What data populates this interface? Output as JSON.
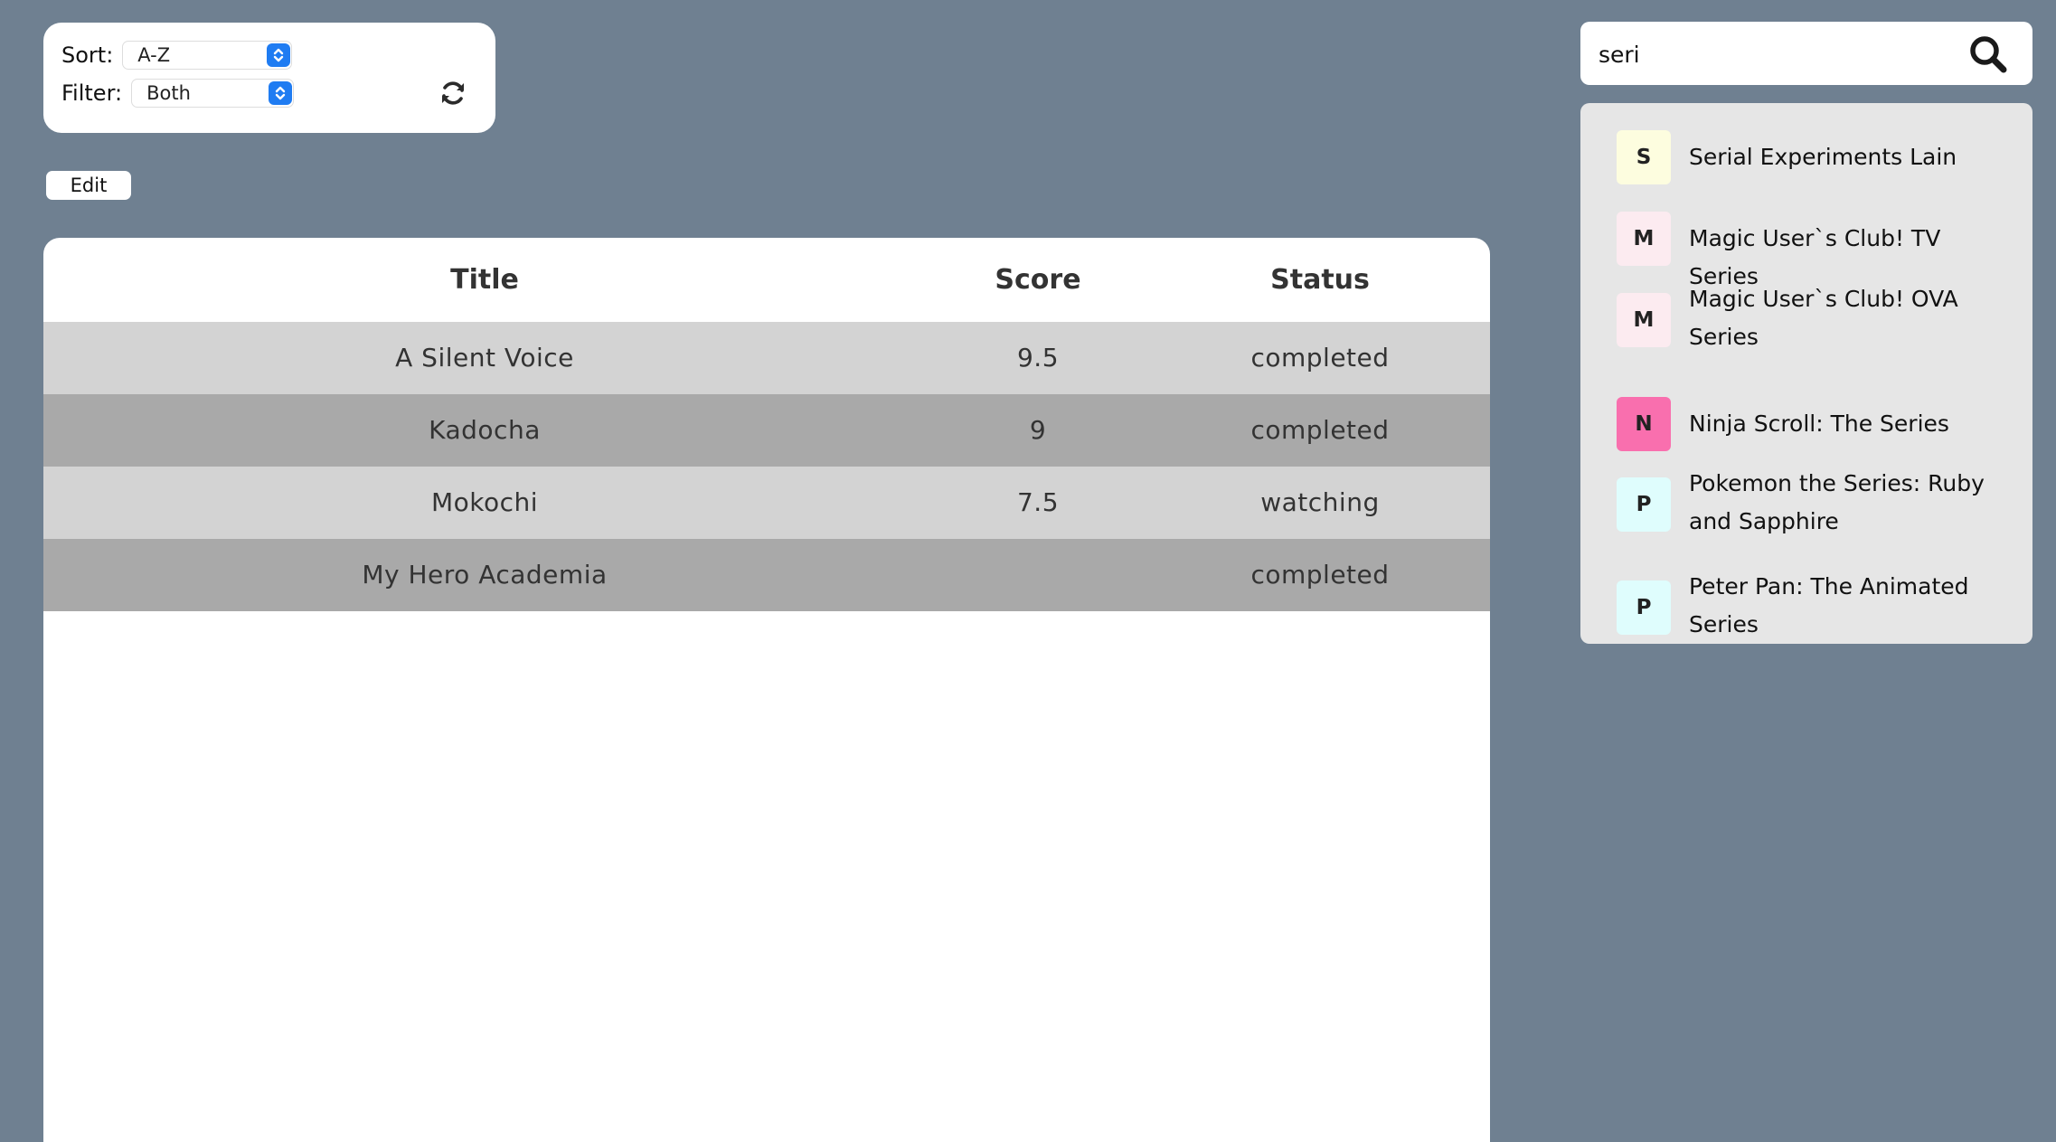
{
  "controls": {
    "sort_label": "Sort:",
    "sort_value": "A-Z",
    "filter_label": "Filter:",
    "filter_value": "Both",
    "refresh_icon": "refresh-icon"
  },
  "edit_label": "Edit",
  "table": {
    "headers": [
      "Title",
      "Score",
      "Status"
    ],
    "rows": [
      {
        "title": "A Silent Voice",
        "score": "9.5",
        "status": "completed"
      },
      {
        "title": "Kadocha",
        "score": "9",
        "status": "completed"
      },
      {
        "title": "Mokochi",
        "score": "7.5",
        "status": "watching"
      },
      {
        "title": "My Hero Academia",
        "score": "",
        "status": "completed"
      }
    ]
  },
  "search": {
    "value": "seri",
    "icon": "search-icon"
  },
  "results": [
    {
      "letter": "S",
      "title": "Serial Experiments Lain",
      "color": "#fdfddf"
    },
    {
      "letter": "M",
      "title": "Magic User`s Club! TV Series",
      "color": "#fcebf0"
    },
    {
      "letter": "M",
      "title": "Magic User`s Club! OVA Series",
      "color": "#fcebf0"
    },
    {
      "letter": "N",
      "title": "Ninja Scroll: The Series",
      "color": "#f96fae"
    },
    {
      "letter": "P",
      "title": "Pokemon the Series: Ruby and Sapphire",
      "color": "#dffdfd"
    },
    {
      "letter": "P",
      "title": "Peter Pan: The Animated Series",
      "color": "#dffdfd"
    }
  ],
  "colors": {
    "background": "#6f8091",
    "row_light": "#d3d3d3",
    "row_dark": "#a9a9a9",
    "accent": "#1f7cf2"
  }
}
